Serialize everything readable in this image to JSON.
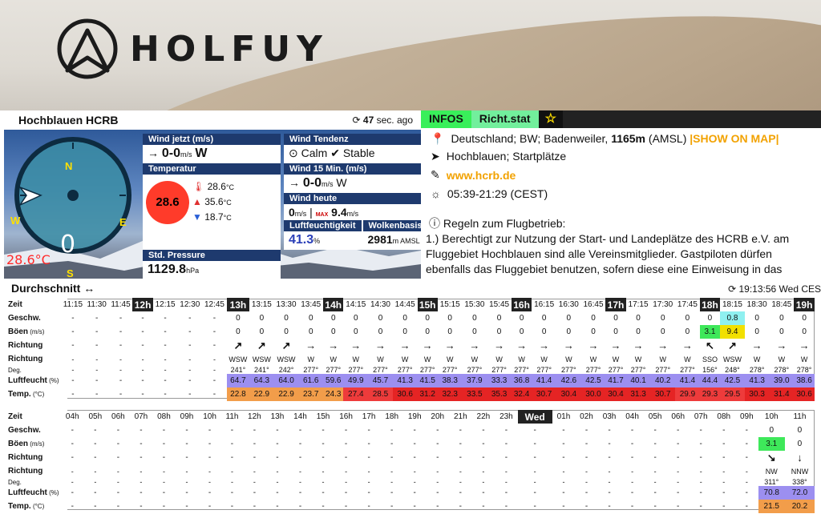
{
  "brand": {
    "name": "HOLFUY"
  },
  "station": {
    "name": "Hochblauen HCRB",
    "updated": "47",
    "updated_unit": "sec. ago",
    "gauge_value": "0",
    "gauge_dirs": [
      "N",
      "E",
      "S",
      "W"
    ],
    "temp_display": "28.6°C"
  },
  "wind_now": {
    "title": "Wind jetzt",
    "unit_label": "(m/s)",
    "value": "0-0",
    "unit": "m/s",
    "dir": "W"
  },
  "wind_trend": {
    "title": "Wind Tendenz",
    "calm": "Calm",
    "stable": "Stable"
  },
  "temperature": {
    "title": "Temperatur",
    "current": "28.6",
    "max": "28.6",
    "max_unit": "°C",
    "high": "35.6",
    "low": "18.7",
    "unit": "°C"
  },
  "wind15": {
    "title": "Wind 15 Min.",
    "unit_label": "(m/s)",
    "value": "0-0",
    "unit": "m/s",
    "dir": "W"
  },
  "wind_today": {
    "title": "Wind heute",
    "min": "0",
    "min_unit": "m/s",
    "max_badge": "MAX",
    "max": "9.4",
    "max_unit": "m/s"
  },
  "humidity": {
    "title": "Luftfeuchtigkeit",
    "value": "41.3",
    "unit": "%"
  },
  "clouds": {
    "title": "Wolkenbasis",
    "value": "2981",
    "unit": "m AMSL"
  },
  "pressure": {
    "title": "Std. Pressure",
    "value": "1129.8",
    "unit": "hPa"
  },
  "info": {
    "tabs": [
      "INFOS",
      "Richt.stat",
      "☆"
    ],
    "location": "Deutschland; BW; Badenweiler,",
    "altitude": "1165m",
    "altitude_suffix": "(AMSL)",
    "show_map": "|SHOW ON MAP|",
    "place": "Hochblauen; Startplätze",
    "website": "www.hcrb.de",
    "sun": "05:39-21:29 (CEST)",
    "rules_title": "Regeln zum Flugbetrieb:",
    "rules_text": "1.) Berechtigt zur Nutzung der Start- und Landeplätze des HCRB e.V. am Fluggebiet Hochblauen sind alle Vereinsmitglieder. Gastpiloten dürfen ebenfalls das Fluggebiet benutzen, sofern diese eine Einweisung in das"
  },
  "average": {
    "title": "Durchschnitt",
    "arrow": "↔",
    "sync": "19:13:56 Wed CES"
  },
  "labels": {
    "zeit": "Zeit",
    "speed": "Geschw.",
    "gust": "Böen",
    "gust_unit": "(m/s)",
    "dir": "Richtung",
    "dir2": "Richtung",
    "deg": "Deg.",
    "hum": "Luftfeucht",
    "hum_unit": "(%)",
    "temp": "Temp.",
    "temp_unit": "(°C)"
  },
  "table1": {
    "times": [
      "11:15",
      "11:30",
      "11:45",
      "12h",
      "12:15",
      "12:30",
      "12:45",
      "13h",
      "13:15",
      "13:30",
      "13:45",
      "14h",
      "14:15",
      "14:30",
      "14:45",
      "15h",
      "15:15",
      "15:30",
      "15:45",
      "16h",
      "16:15",
      "16:30",
      "16:45",
      "17h",
      "17:15",
      "17:30",
      "17:45",
      "18h",
      "18:15",
      "18:30",
      "18:45",
      "19h"
    ],
    "speed": [
      "-",
      "-",
      "-",
      "-",
      "-",
      "-",
      "-",
      "0",
      "0",
      "0",
      "0",
      "0",
      "0",
      "0",
      "0",
      "0",
      "0",
      "0",
      "0",
      "0",
      "0",
      "0",
      "0",
      "0",
      "0",
      "0",
      "0",
      "0",
      "0.8",
      "0",
      "0",
      "0"
    ],
    "gust": [
      "-",
      "-",
      "-",
      "-",
      "-",
      "-",
      "-",
      "0",
      "0",
      "0",
      "0",
      "0",
      "0",
      "0",
      "0",
      "0",
      "0",
      "0",
      "0",
      "0",
      "0",
      "0",
      "0",
      "0",
      "0",
      "0",
      "0",
      "3.1",
      "9.4",
      "0",
      "0",
      "0"
    ],
    "dirname": [
      "-",
      "-",
      "-",
      "-",
      "-",
      "-",
      "-",
      "WSW",
      "WSW",
      "WSW",
      "W",
      "W",
      "W",
      "W",
      "W",
      "W",
      "W",
      "W",
      "W",
      "W",
      "W",
      "W",
      "W",
      "W",
      "W",
      "W",
      "W",
      "SSO",
      "WSW",
      "W",
      "W",
      "W"
    ],
    "deg": [
      "-",
      "-",
      "-",
      "-",
      "-",
      "-",
      "-",
      "241°",
      "241°",
      "242°",
      "277°",
      "277°",
      "277°",
      "277°",
      "277°",
      "277°",
      "277°",
      "277°",
      "277°",
      "277°",
      "277°",
      "277°",
      "277°",
      "277°",
      "277°",
      "277°",
      "277°",
      "156°",
      "248°",
      "278°",
      "278°",
      "278°"
    ],
    "hum": [
      "-",
      "-",
      "-",
      "-",
      "-",
      "-",
      "-",
      "64.7",
      "64.3",
      "64.0",
      "61.6",
      "59.6",
      "49.9",
      "45.7",
      "41.3",
      "41.5",
      "38.3",
      "37.9",
      "33.3",
      "36.8",
      "41.4",
      "42.6",
      "42.5",
      "41.7",
      "40.1",
      "40.2",
      "41.4",
      "44.4",
      "42.5",
      "41.3",
      "39.0",
      "38.6"
    ],
    "temp": [
      "-",
      "-",
      "-",
      "-",
      "-",
      "-",
      "-",
      "22.8",
      "22.9",
      "22.9",
      "23.7",
      "24.3",
      "27.4",
      "28.5",
      "30.6",
      "31.2",
      "32.3",
      "33.5",
      "35.3",
      "32.4",
      "30.7",
      "30.4",
      "30.0",
      "30.4",
      "31.3",
      "30.7",
      "29.9",
      "29.3",
      "29.5",
      "30.3",
      "31.4",
      "30.6"
    ]
  },
  "table2": {
    "times": [
      "04h",
      "05h",
      "06h",
      "07h",
      "08h",
      "09h",
      "10h",
      "11h",
      "12h",
      "13h",
      "14h",
      "15h",
      "16h",
      "17h",
      "18h",
      "19h",
      "20h",
      "21h",
      "22h",
      "23h",
      "Wed",
      "01h",
      "02h",
      "03h",
      "04h",
      "05h",
      "06h",
      "07h",
      "08h",
      "09h",
      "10h",
      "11h"
    ],
    "speed": [
      "-",
      "-",
      "-",
      "-",
      "-",
      "-",
      "-",
      "-",
      "-",
      "-",
      "-",
      "-",
      "-",
      "-",
      "-",
      "-",
      "-",
      "-",
      "-",
      "-",
      "-",
      "-",
      "-",
      "-",
      "-",
      "-",
      "-",
      "-",
      "-",
      "-",
      "0",
      "0"
    ],
    "gust": [
      "-",
      "-",
      "-",
      "-",
      "-",
      "-",
      "-",
      "-",
      "-",
      "-",
      "-",
      "-",
      "-",
      "-",
      "-",
      "-",
      "-",
      "-",
      "-",
      "-",
      "-",
      "-",
      "-",
      "-",
      "-",
      "-",
      "-",
      "-",
      "-",
      "-",
      "3.1",
      "0"
    ],
    "dirname": [
      "-",
      "-",
      "-",
      "-",
      "-",
      "-",
      "-",
      "-",
      "-",
      "-",
      "-",
      "-",
      "-",
      "-",
      "-",
      "-",
      "-",
      "-",
      "-",
      "-",
      "-",
      "-",
      "-",
      "-",
      "-",
      "-",
      "-",
      "-",
      "-",
      "-",
      "NW",
      "NNW"
    ],
    "deg": [
      "-",
      "-",
      "-",
      "-",
      "-",
      "-",
      "-",
      "-",
      "-",
      "-",
      "-",
      "-",
      "-",
      "-",
      "-",
      "-",
      "-",
      "-",
      "-",
      "-",
      "-",
      "-",
      "-",
      "-",
      "-",
      "-",
      "-",
      "-",
      "-",
      "-",
      "311°",
      "338°"
    ],
    "hum": [
      "-",
      "-",
      "-",
      "-",
      "-",
      "-",
      "-",
      "-",
      "-",
      "-",
      "-",
      "-",
      "-",
      "-",
      "-",
      "-",
      "-",
      "-",
      "-",
      "-",
      "-",
      "-",
      "-",
      "-",
      "-",
      "-",
      "-",
      "-",
      "-",
      "-",
      "70.8",
      "72.0"
    ],
    "temp": [
      "-",
      "-",
      "-",
      "-",
      "-",
      "-",
      "-",
      "-",
      "-",
      "-",
      "-",
      "-",
      "-",
      "-",
      "-",
      "-",
      "-",
      "-",
      "-",
      "-",
      "-",
      "-",
      "-",
      "-",
      "-",
      "-",
      "-",
      "-",
      "-",
      "-",
      "21.5",
      "20.2"
    ]
  }
}
